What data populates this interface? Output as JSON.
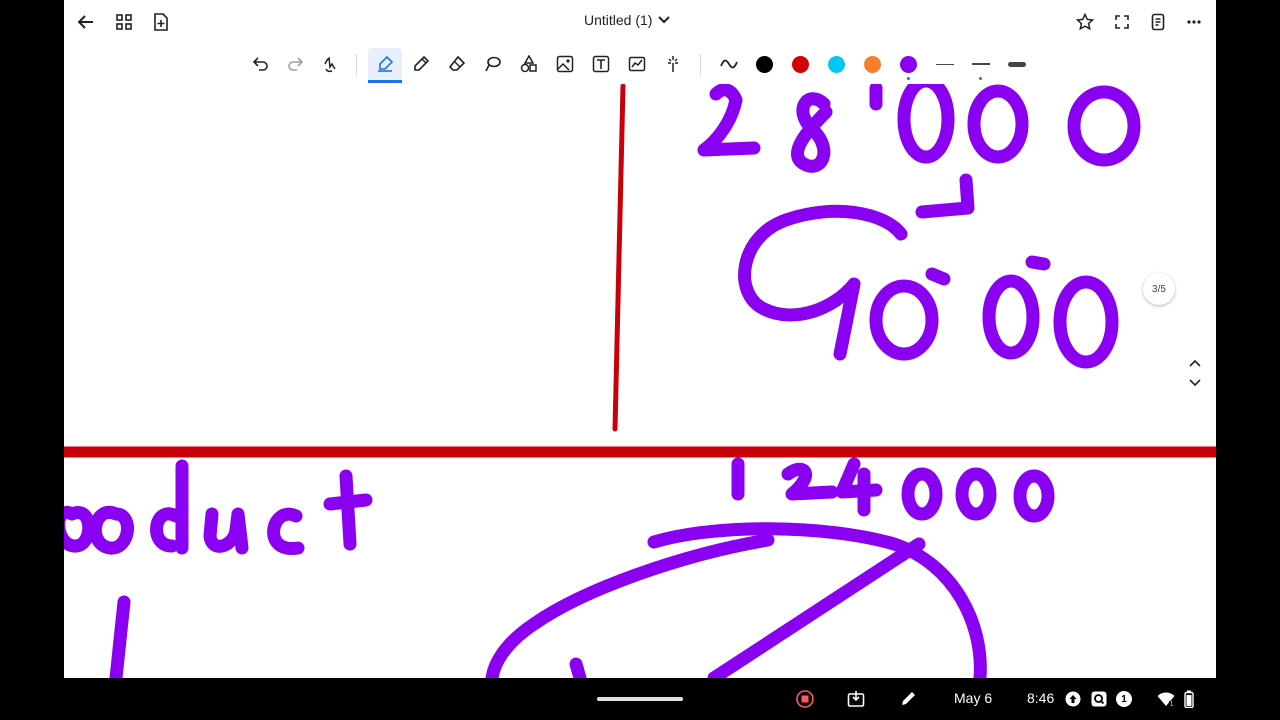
{
  "header": {
    "title": "Untitled (1)"
  },
  "toolbar": {
    "tools": [
      "undo-icon",
      "redo-icon",
      "select-icon",
      "highlighter-icon",
      "pen-icon",
      "eraser-icon",
      "lasso-icon",
      "shapes-icon",
      "image-icon",
      "text-icon",
      "chart-icon",
      "laser-icon"
    ],
    "active_tool": "highlighter-icon",
    "colors": [
      "#000000",
      "#d50000",
      "#00c8f0",
      "#f4802b",
      "#8a00f0"
    ],
    "selected_color": "#8a00f0"
  },
  "canvas": {
    "ink_color": "#8a00f0",
    "line_color": "#c8000a"
  },
  "pager": {
    "label": "3/5"
  },
  "shelf": {
    "date": "May 6",
    "time": "8:46",
    "notification_count": "1"
  }
}
